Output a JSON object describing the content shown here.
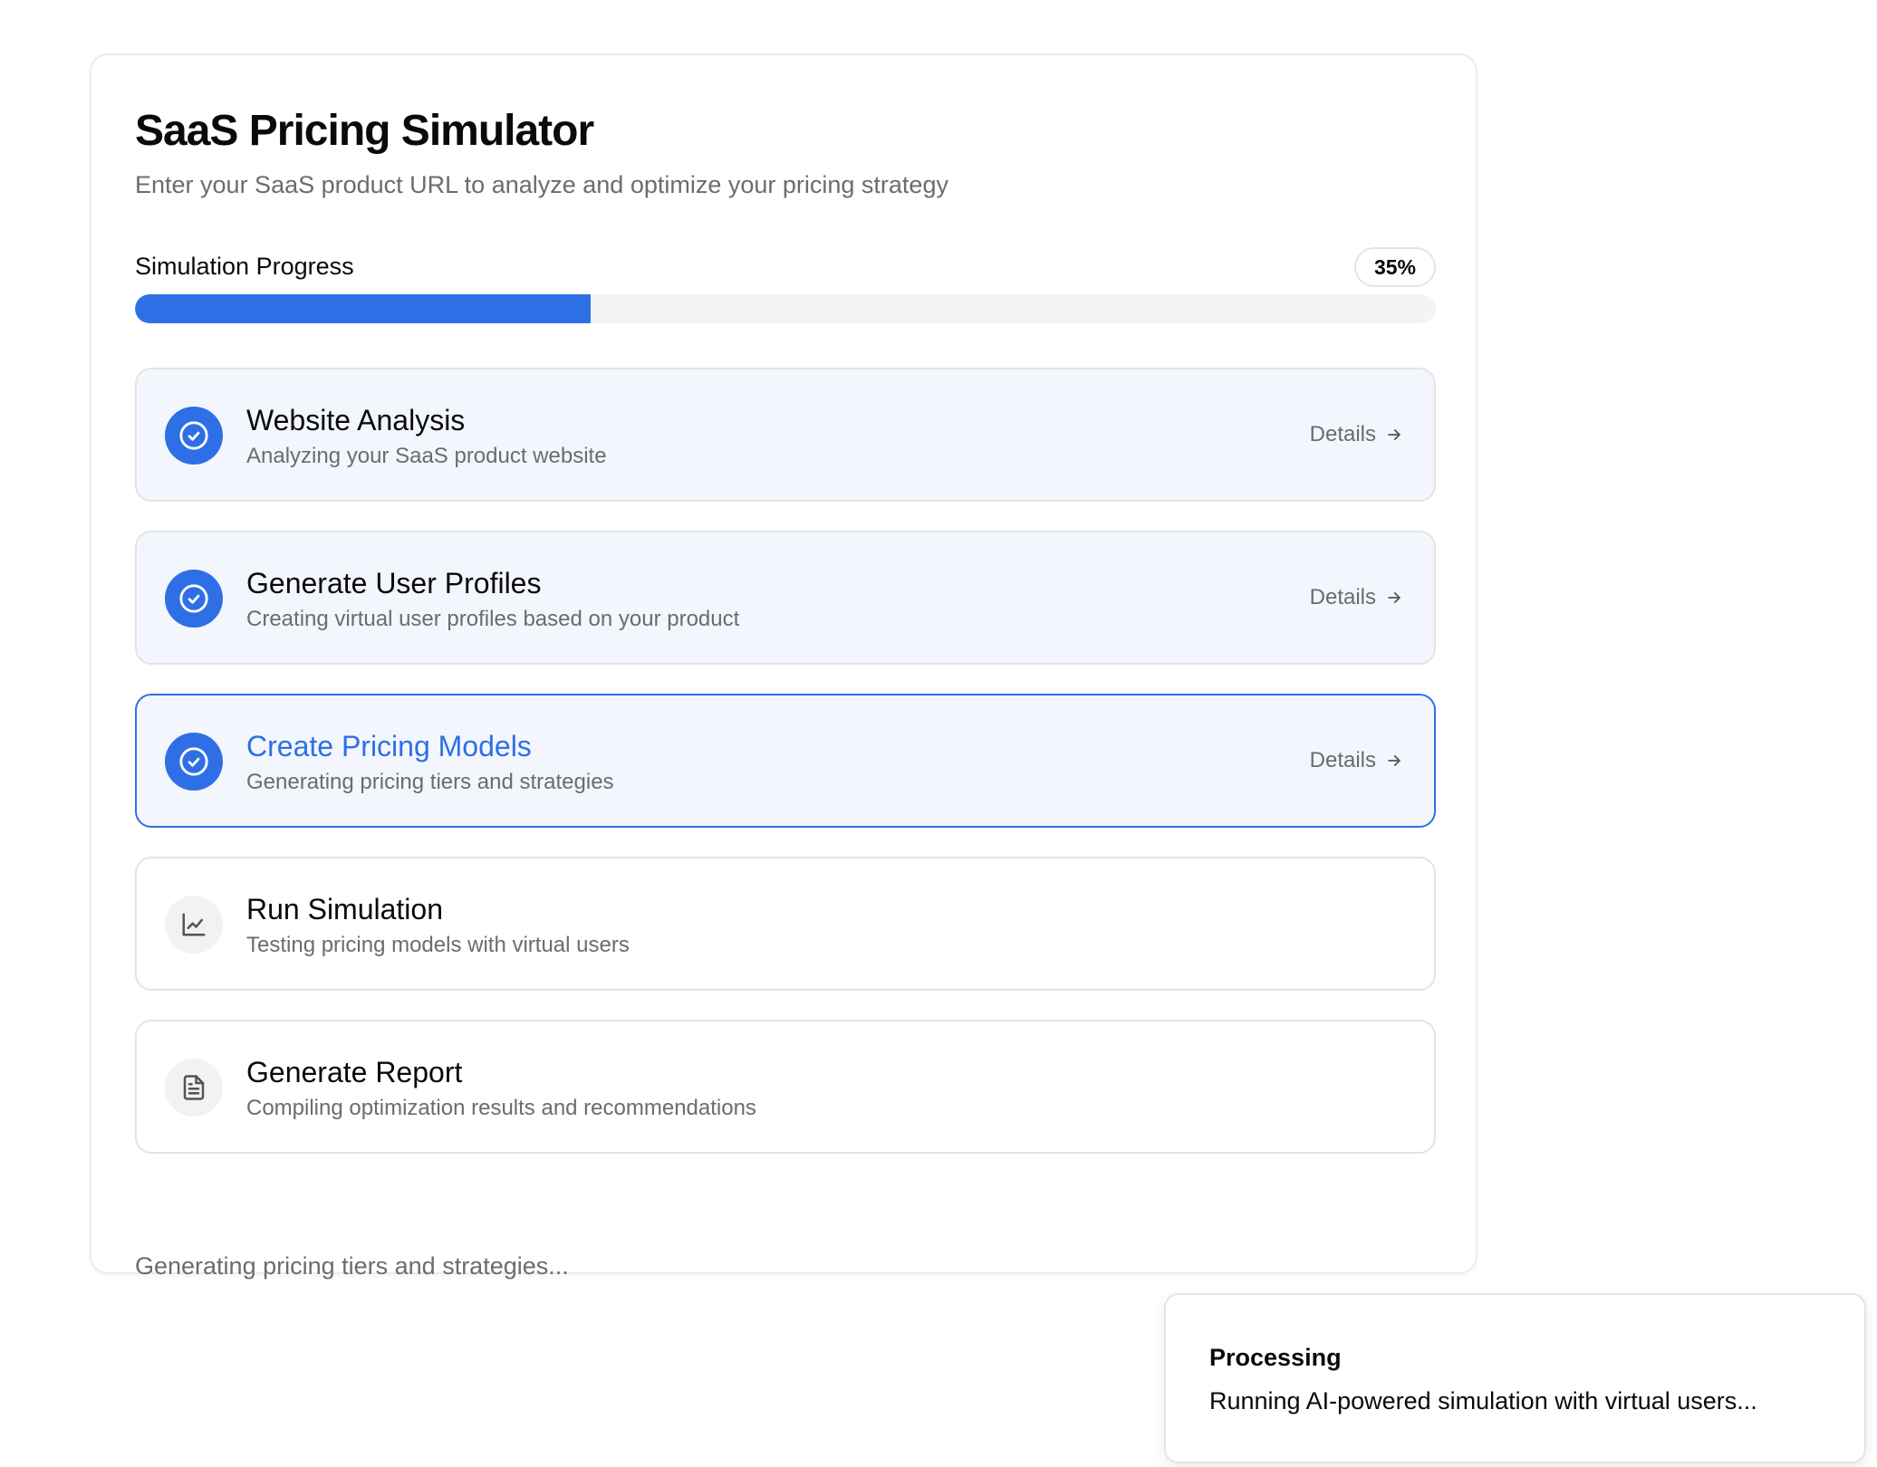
{
  "app": {
    "title": "SaaS Pricing Simulator",
    "subtitle": "Enter your SaaS product URL to analyze and optimize your pricing strategy"
  },
  "progress": {
    "label": "Simulation Progress",
    "percent_text": "35%",
    "value": 35,
    "color": "#2f6fe6"
  },
  "steps": [
    {
      "title": "Website Analysis",
      "description": "Analyzing your SaaS product website",
      "status": "done",
      "icon": "check-circle-icon",
      "details_label": "Details"
    },
    {
      "title": "Generate User Profiles",
      "description": "Creating virtual user profiles based on your product",
      "status": "done",
      "icon": "check-circle-icon",
      "details_label": "Details"
    },
    {
      "title": "Create Pricing Models",
      "description": "Generating pricing tiers and strategies",
      "status": "active",
      "icon": "check-circle-icon",
      "details_label": "Details"
    },
    {
      "title": "Run Simulation",
      "description": "Testing pricing models with virtual users",
      "status": "pending",
      "icon": "line-chart-icon"
    },
    {
      "title": "Generate Report",
      "description": "Compiling optimization results and recommendations",
      "status": "pending",
      "icon": "document-icon"
    }
  ],
  "status_text": "Generating pricing tiers and strategies...",
  "toast": {
    "title": "Processing",
    "description": "Running AI-powered simulation with virtual users..."
  }
}
